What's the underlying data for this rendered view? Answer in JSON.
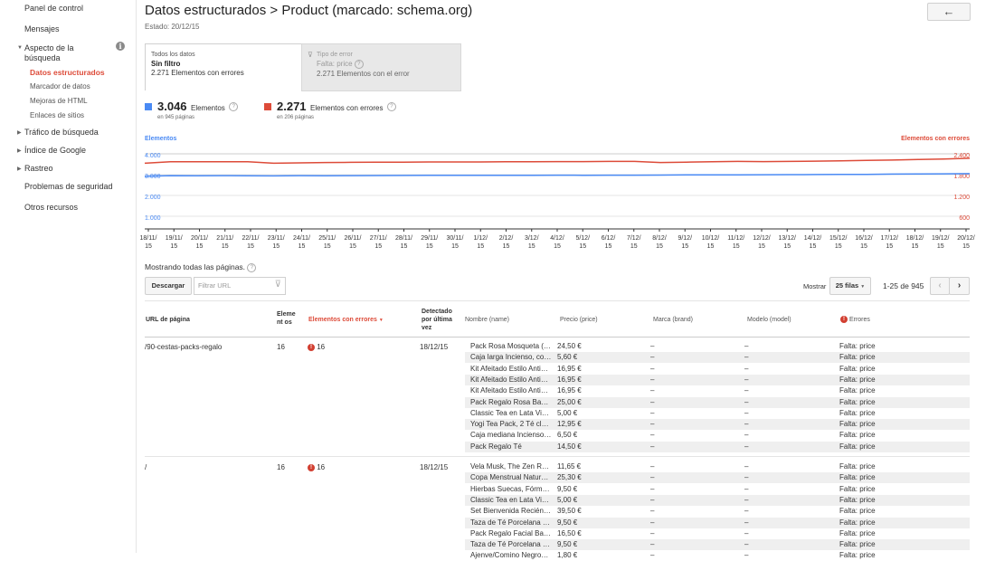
{
  "sidebar": {
    "items": [
      {
        "label": "Panel de control"
      },
      {
        "label": "Mensajes"
      },
      {
        "label": "Aspecto de la búsqueda"
      },
      {
        "label": "Datos estructurados"
      },
      {
        "label": "Marcador de datos"
      },
      {
        "label": "Mejoras de HTML"
      },
      {
        "label": "Enlaces de sitios"
      },
      {
        "label": "Tráfico de búsqueda"
      },
      {
        "label": "Índice de Google"
      },
      {
        "label": "Rastreo"
      },
      {
        "label": "Problemas de seguridad"
      },
      {
        "label": "Otros recursos"
      }
    ],
    "aspect_line1": "Aspecto de la",
    "aspect_line2": "búsqueda"
  },
  "header": {
    "title": "Datos estructurados > Product (marcado: schema.org)",
    "status": "Estado: 20/12/15",
    "back_icon": "←"
  },
  "tabs": {
    "all": {
      "label": "Todos los datos",
      "filter": "Sin filtro",
      "detail": "2.271 Elementos con errores"
    },
    "error": {
      "label": "Tipo de error",
      "filter": "Falta: price",
      "detail": "2.271 Elementos con el error"
    }
  },
  "stats": {
    "items": {
      "value": "3.046",
      "label": "Elementos",
      "pages": "en 945 páginas",
      "color": "#4a8af4"
    },
    "errors": {
      "value": "2.271",
      "label": "Elementos con errores",
      "pages": "en 206 páginas",
      "color": "#dd4b39"
    }
  },
  "chart_data": {
    "type": "line",
    "x": [
      "18/11/15",
      "19/11/15",
      "20/11/15",
      "21/11/15",
      "22/11/15",
      "23/11/15",
      "24/11/15",
      "25/11/15",
      "26/11/15",
      "27/11/15",
      "28/11/15",
      "29/11/15",
      "30/11/15",
      "1/12/15",
      "2/12/15",
      "3/12/15",
      "4/12/15",
      "5/12/15",
      "6/12/15",
      "7/12/15",
      "8/12/15",
      "9/12/15",
      "10/12/15",
      "11/12/15",
      "12/12/15",
      "13/12/15",
      "14/12/15",
      "15/12/15",
      "16/12/15",
      "17/12/15",
      "18/12/15",
      "19/12/15",
      "20/12/15"
    ],
    "x_tick_labels": [
      [
        "18/11/",
        "15"
      ],
      [
        "19/11/",
        "15"
      ],
      [
        "20/11/",
        "15"
      ],
      [
        "21/11/",
        "15"
      ],
      [
        "22/11/",
        "15"
      ],
      [
        "23/11/",
        "15"
      ],
      [
        "24/11/",
        "15"
      ],
      [
        "25/11/",
        "15"
      ],
      [
        "26/11/",
        "15"
      ],
      [
        "27/11/",
        "15"
      ],
      [
        "28/11/",
        "15"
      ],
      [
        "29/11/",
        "15"
      ],
      [
        "30/11/",
        "15"
      ],
      [
        "1/12/",
        "15"
      ],
      [
        "2/12/",
        "15"
      ],
      [
        "3/12/",
        "15"
      ],
      [
        "4/12/",
        "15"
      ],
      [
        "5/12/",
        "15"
      ],
      [
        "6/12/",
        "15"
      ],
      [
        "7/12/",
        "15"
      ],
      [
        "8/12/",
        "15"
      ],
      [
        "9/12/",
        "15"
      ],
      [
        "10/12/",
        "15"
      ],
      [
        "11/12/",
        "15"
      ],
      [
        "12/12/",
        "15"
      ],
      [
        "13/12/",
        "15"
      ],
      [
        "14/12/",
        "15"
      ],
      [
        "15/12/",
        "15"
      ],
      [
        "16/12/",
        "15"
      ],
      [
        "17/12/",
        "15"
      ],
      [
        "18/12/",
        "15"
      ],
      [
        "19/12/",
        "15"
      ],
      [
        "20/12/",
        "15"
      ]
    ],
    "left_axis": {
      "label": "Elementos",
      "ticks": [
        "4.000",
        "3.000",
        "2.000",
        "1.000"
      ],
      "ylim": [
        0,
        4000
      ],
      "color": "#4a8af4"
    },
    "right_axis": {
      "label": "Elementos con errores",
      "ticks": [
        "2.400",
        "1.800",
        "1.200",
        "600"
      ],
      "ylim": [
        0,
        2400
      ],
      "color": "#dd4b39"
    },
    "series": [
      {
        "name": "Elementos",
        "axis": "left",
        "color": "#4a8af4",
        "values": [
          2920,
          2950,
          2945,
          2950,
          2945,
          2940,
          2950,
          2945,
          2950,
          2955,
          2960,
          2965,
          2965,
          2965,
          2970,
          2970,
          2975,
          2970,
          2975,
          2975,
          2980,
          2990,
          2990,
          2990,
          2995,
          3000,
          3005,
          3010,
          3015,
          3025,
          3035,
          3040,
          3046
        ]
      },
      {
        "name": "Elementos con errores",
        "axis": "right",
        "color": "#dd4b39",
        "values": [
          2130,
          2170,
          2170,
          2170,
          2170,
          2130,
          2140,
          2150,
          2155,
          2160,
          2160,
          2165,
          2165,
          2165,
          2170,
          2170,
          2175,
          2175,
          2180,
          2180,
          2150,
          2160,
          2170,
          2180,
          2175,
          2180,
          2190,
          2200,
          2210,
          2220,
          2235,
          2250,
          2271
        ]
      }
    ],
    "grid": true
  },
  "table": {
    "showing": "Mostrando todas las páginas.",
    "download_label": "Descargar",
    "filter_placeholder": "Filtrar URL",
    "show_label": "Mostrar",
    "rows_option": "25 filas",
    "range": "1-25 de 945",
    "headers": {
      "url": "URL de página",
      "elements": "Element os",
      "errors": "Elementos con errores",
      "detected": "Detectado por última vez",
      "name": "Nombre (name)",
      "price": "Precio (price)",
      "brand": "Marca (brand)",
      "model": "Modelo (model)",
      "err_col": "Errores"
    },
    "rows": [
      {
        "url": "/90-cestas-packs-regalo",
        "elements": "16",
        "errors": "16",
        "detected": "18/12/15",
        "items": [
          {
            "name": "Pack Rosa Mosqueta (…",
            "price": "24,50 €",
            "brand": "–",
            "model": "–",
            "error": "Falta: price"
          },
          {
            "name": "Caja larga Incienso, co…",
            "price": "5,60 €",
            "brand": "–",
            "model": "–",
            "error": "Falta: price"
          },
          {
            "name": "Kit Afeitado Estilo Anti…",
            "price": "16,95 €",
            "brand": "–",
            "model": "–",
            "error": "Falta: price"
          },
          {
            "name": "Kit Afeitado Estilo Anti…",
            "price": "16,95 €",
            "brand": "–",
            "model": "–",
            "error": "Falta: price"
          },
          {
            "name": "Kit Afeitado Estilo Anti…",
            "price": "16,95 €",
            "brand": "–",
            "model": "–",
            "error": "Falta: price"
          },
          {
            "name": "Pack Regalo Rosa Ba…",
            "price": "25,00 €",
            "brand": "–",
            "model": "–",
            "error": "Falta: price"
          },
          {
            "name": "Classic Tea en Lata Vi…",
            "price": "5,00 €",
            "brand": "–",
            "model": "–",
            "error": "Falta: price"
          },
          {
            "name": "Yogi Tea Pack, 2 Té cl…",
            "price": "12,95 €",
            "brand": "–",
            "model": "–",
            "error": "Falta: price"
          },
          {
            "name": "Caja mediana Incienso…",
            "price": "6,50 €",
            "brand": "–",
            "model": "–",
            "error": "Falta: price"
          },
          {
            "name": "Pack Regalo Té",
            "price": "14,50 €",
            "brand": "–",
            "model": "–",
            "error": "Falta: price"
          }
        ]
      },
      {
        "url": "/",
        "elements": "16",
        "errors": "16",
        "detected": "18/12/15",
        "items": [
          {
            "name": "Vela Musk, The Zen R…",
            "price": "11,65 €",
            "brand": "–",
            "model": "–",
            "error": "Falta: price"
          },
          {
            "name": "Copa Menstrual Natur…",
            "price": "25,30 €",
            "brand": "–",
            "model": "–",
            "error": "Falta: price"
          },
          {
            "name": "Hierbas Suecas, Fórm…",
            "price": "9,50 €",
            "brand": "–",
            "model": "–",
            "error": "Falta: price"
          },
          {
            "name": "Classic Tea en Lata Vi…",
            "price": "5,00 €",
            "brand": "–",
            "model": "–",
            "error": "Falta: price"
          },
          {
            "name": "Set Bienvenida Recién…",
            "price": "39,50 €",
            "brand": "–",
            "model": "–",
            "error": "Falta: price"
          },
          {
            "name": "Taza de Té Porcelana …",
            "price": "9,50 €",
            "brand": "–",
            "model": "–",
            "error": "Falta: price"
          },
          {
            "name": "Pack Regalo Facial Ba…",
            "price": "16,50 €",
            "brand": "–",
            "model": "–",
            "error": "Falta: price"
          },
          {
            "name": "Taza de Té Porcelana …",
            "price": "9,50 €",
            "brand": "–",
            "model": "–",
            "error": "Falta: price"
          },
          {
            "name": "Ajenve/Comino Negro…",
            "price": "1,80 €",
            "brand": "–",
            "model": "–",
            "error": "Falta: price"
          }
        ]
      }
    ]
  }
}
